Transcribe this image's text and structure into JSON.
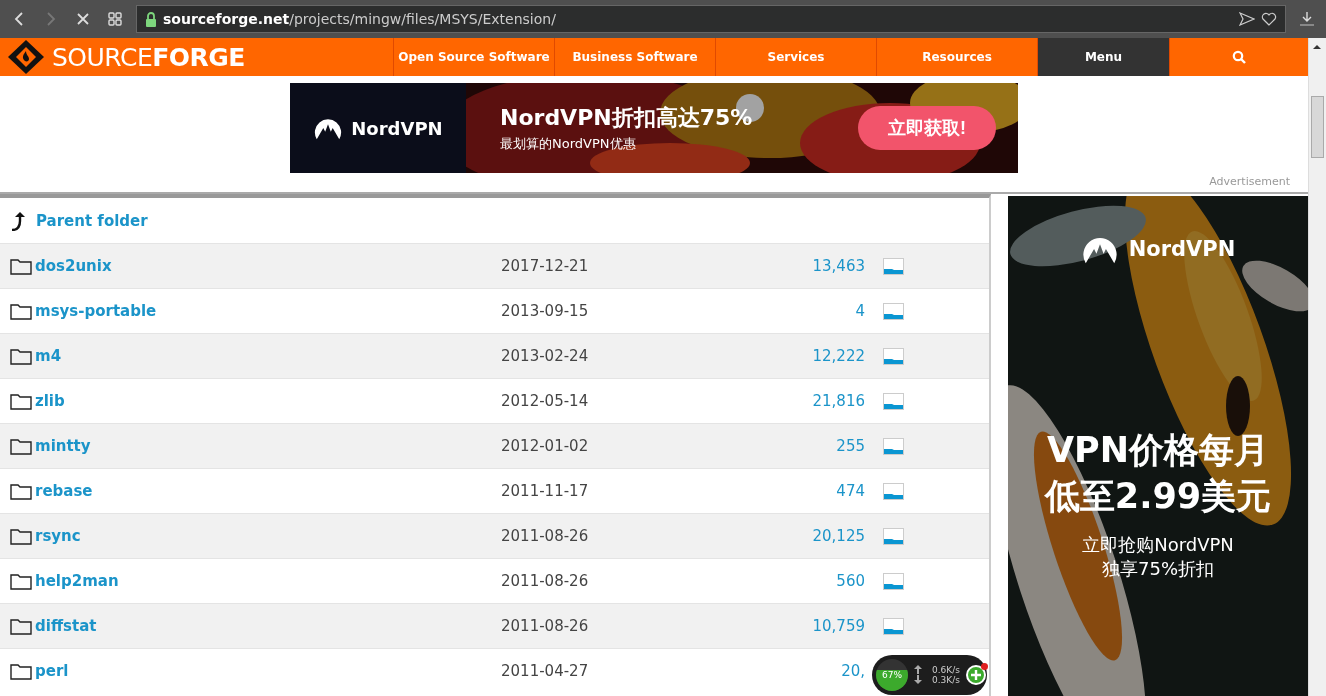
{
  "browser": {
    "url_host": "sourceforge.net",
    "url_path": "/projects/mingw/files/MSYS/Extension/"
  },
  "nav": {
    "logo_light": "SOURCE",
    "logo_bold": "FORGE",
    "items": [
      {
        "label": "Open Source Software",
        "kind": "link"
      },
      {
        "label": "Business Software",
        "kind": "link"
      },
      {
        "label": "Services",
        "kind": "link"
      },
      {
        "label": "Resources",
        "kind": "link"
      },
      {
        "label": "Menu",
        "kind": "menu"
      },
      {
        "kind": "search"
      }
    ]
  },
  "banner": {
    "brand": "NordVPN",
    "headline": "NordVPN折扣高达75%",
    "subline": "最划算的NordVPN优惠",
    "button": "立即获取!",
    "note": "Advertisement"
  },
  "parent_folder": "Parent folder",
  "files": [
    {
      "name": "dos2unix",
      "date": "2017-12-21",
      "downloads": "13,463"
    },
    {
      "name": "msys-portable",
      "date": "2013-09-15",
      "downloads": "4"
    },
    {
      "name": "m4",
      "date": "2013-02-24",
      "downloads": "12,222"
    },
    {
      "name": "zlib",
      "date": "2012-05-14",
      "downloads": "21,816"
    },
    {
      "name": "mintty",
      "date": "2012-01-02",
      "downloads": "255"
    },
    {
      "name": "rebase",
      "date": "2011-11-17",
      "downloads": "474"
    },
    {
      "name": "rsync",
      "date": "2011-08-26",
      "downloads": "20,125"
    },
    {
      "name": "help2man",
      "date": "2011-08-26",
      "downloads": "560"
    },
    {
      "name": "diffstat",
      "date": "2011-08-26",
      "downloads": "10,759"
    },
    {
      "name": "perl",
      "date": "2011-04-27",
      "downloads": "20,"
    }
  ],
  "side_ad": {
    "brand": "NordVPN",
    "headline_1": "VPN价格每月",
    "headline_2": "低至2.99美元",
    "text_1": "立即抢购NordVPN",
    "text_2": "独享75%折扣"
  },
  "speed_widget": {
    "percent": "67%",
    "upload": "0.6K/s",
    "download": "0.3K/s"
  }
}
